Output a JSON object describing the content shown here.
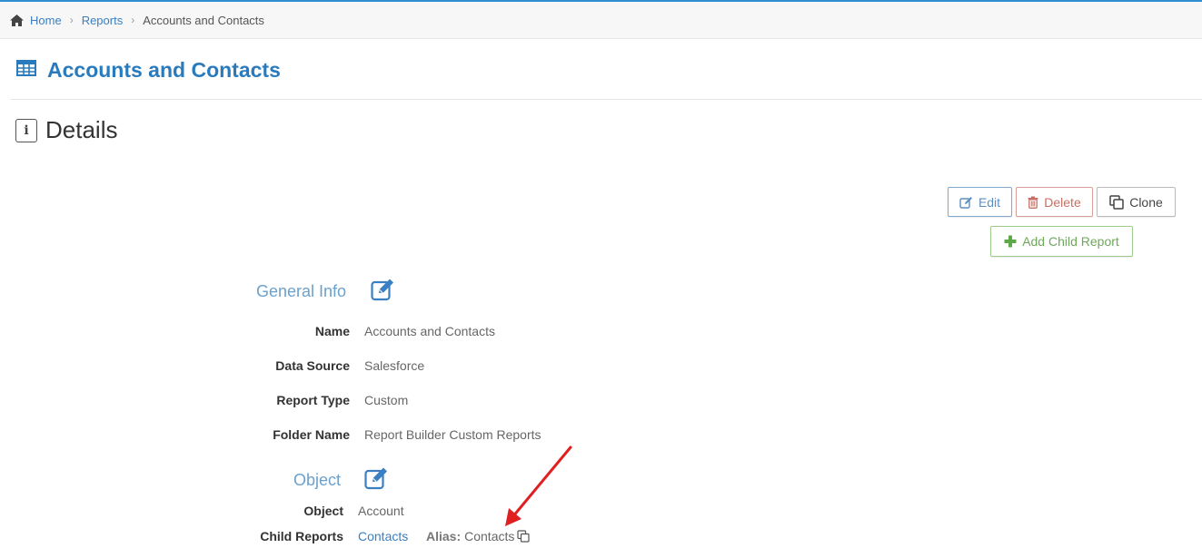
{
  "breadcrumb": {
    "home": "Home",
    "reports": "Reports",
    "current": "Accounts and Contacts"
  },
  "page": {
    "title": "Accounts and Contacts",
    "section_title": "Details"
  },
  "actions": {
    "edit": "Edit",
    "delete": "Delete",
    "clone": "Clone",
    "add_child": "Add Child Report"
  },
  "general_info": {
    "heading": "General Info",
    "fields": [
      {
        "label": "Name",
        "value": "Accounts and Contacts"
      },
      {
        "label": "Data Source",
        "value": "Salesforce"
      },
      {
        "label": "Report Type",
        "value": "Custom"
      },
      {
        "label": "Folder Name",
        "value": "Report Builder Custom Reports"
      }
    ]
  },
  "object_section": {
    "heading": "Object",
    "object_label": "Object",
    "object_value": "Account",
    "child_label": "Child Reports",
    "child_link": "Contacts",
    "alias_label": "Alias:",
    "alias_value": "Contacts"
  },
  "colors": {
    "accent": "#2a7bbd",
    "link": "#3a7fc1",
    "delete": "#c96e63",
    "add": "#6ea85a",
    "annotation_arrow": "#e02020"
  },
  "icons": {
    "home": "home-icon",
    "table": "table-icon",
    "info": "info-icon",
    "edit": "edit-icon",
    "trash": "trash-icon",
    "copy": "copy-icon",
    "plus": "plus-icon"
  }
}
